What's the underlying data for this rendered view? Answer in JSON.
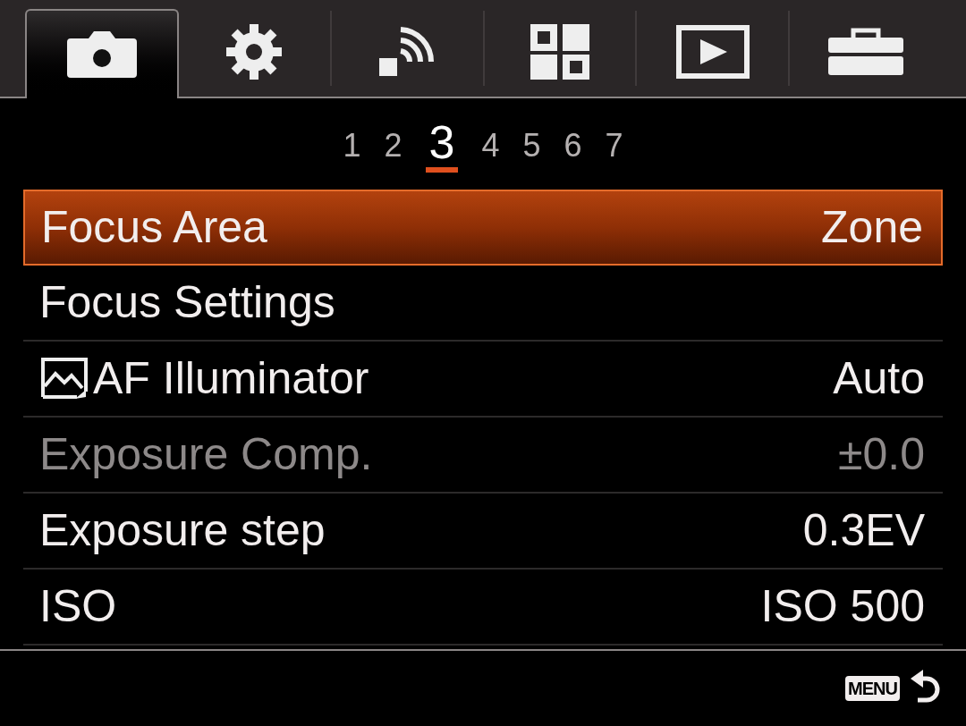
{
  "tabs": [
    {
      "kind": "camera",
      "selected": true
    },
    {
      "kind": "gear",
      "selected": false
    },
    {
      "kind": "wireless",
      "selected": false
    },
    {
      "kind": "apps",
      "selected": false
    },
    {
      "kind": "playback",
      "selected": false
    },
    {
      "kind": "toolbox",
      "selected": false
    }
  ],
  "pages": [
    {
      "label": "1",
      "selected": false
    },
    {
      "label": "2",
      "selected": false
    },
    {
      "label": "3",
      "selected": true
    },
    {
      "label": "4",
      "selected": false
    },
    {
      "label": "5",
      "selected": false
    },
    {
      "label": "6",
      "selected": false
    },
    {
      "label": "7",
      "selected": false
    }
  ],
  "items": [
    {
      "label": "Focus Area",
      "value": "Zone",
      "selected": true,
      "disabled": false
    },
    {
      "label": "Focus Settings",
      "selected": false,
      "disabled": false
    },
    {
      "label": "AF Illuminator",
      "value": "Auto",
      "kind": "icon-row",
      "selected": false,
      "disabled": false
    },
    {
      "label": "Exposure Comp.",
      "value": "±0.0",
      "selected": false,
      "disabled": true
    },
    {
      "label": "Exposure step",
      "value": "0.3EV",
      "selected": false,
      "disabled": false
    },
    {
      "label": "ISO",
      "value": "ISO 500",
      "selected": false,
      "disabled": false
    }
  ],
  "footer": {
    "menu_key": "MENU"
  }
}
